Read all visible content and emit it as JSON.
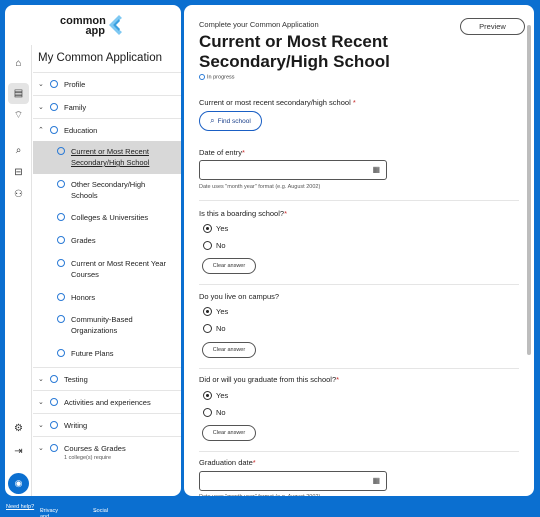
{
  "brand": {
    "line1": "common",
    "line2": "app"
  },
  "nav": {
    "title": "My Common Application",
    "items": [
      {
        "label": "Profile"
      },
      {
        "label": "Family"
      },
      {
        "label": "Education"
      },
      {
        "label": "Testing"
      },
      {
        "label": "Activities and experiences"
      },
      {
        "label": "Writing"
      },
      {
        "label": "Courses & Grades",
        "sub": "1 college(s) require"
      }
    ],
    "education_sub": [
      {
        "line1": "Current or Most Recent",
        "line2": "Secondary/High School"
      },
      {
        "line1": "Other Secondary/High",
        "line2": "Schools"
      },
      {
        "line1": "Colleges & Universities",
        "line2": ""
      },
      {
        "line1": "Grades",
        "line2": ""
      },
      {
        "line1": "Current or Most Recent Year",
        "line2": "Courses"
      },
      {
        "line1": "Honors",
        "line2": ""
      },
      {
        "line1": "Community-Based",
        "line2": "Organizations"
      },
      {
        "line1": "Future Plans",
        "line2": ""
      }
    ]
  },
  "main": {
    "eyebrow": "Complete your Common Application",
    "preview": "Preview",
    "title_line1": "Current or Most Recent",
    "title_line2": "Secondary/High School",
    "status": "In progress",
    "school_label": "Current or most recent secondary/high school",
    "find_school": "Find school",
    "date_entry_label": "Date of entry",
    "date_hint": "Date uses \"month year\" format (e.g. August 2002)",
    "boarding_label": "Is this a boarding school?",
    "campus_label": "Do you live on campus?",
    "graduate_label": "Did or will you graduate from this school?",
    "graduation_date_label": "Graduation date",
    "yes": "Yes",
    "no": "No",
    "clear": "Clear answer",
    "required_mark": "*"
  },
  "footer": {
    "help": "Need help?",
    "privacy": "Privacy and legal",
    "social": "Social"
  }
}
